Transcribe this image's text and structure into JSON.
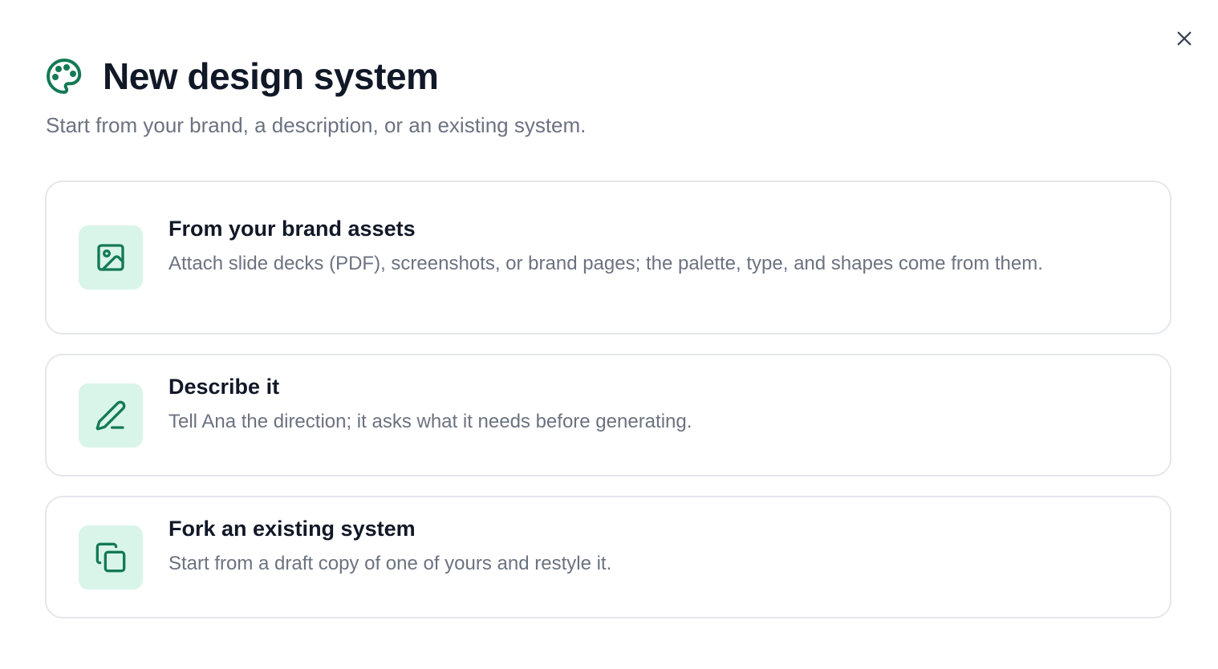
{
  "dialog": {
    "title": "New design system",
    "subtitle": "Start from your brand, a description, or an existing system.",
    "header_icon": "palette-icon",
    "close_icon": "close-icon"
  },
  "options": [
    {
      "title": "From your brand assets",
      "description": "Attach slide decks (PDF), screenshots, or brand pages; the palette, type, and shapes come from them.",
      "icon": "image-icon"
    },
    {
      "title": "Describe it",
      "description": "Tell Ana the direction; it asks what it needs before generating.",
      "icon": "pencil-icon"
    },
    {
      "title": "Fork an existing system",
      "description": "Start from a draft copy of one of yours and restyle it.",
      "icon": "copy-icon"
    }
  ],
  "colors": {
    "accent": "#137a55",
    "icon_tile_bg": "#d9f5ea",
    "title_text": "#111827",
    "muted_text": "#6b7280",
    "card_border": "#e5e7eb"
  }
}
